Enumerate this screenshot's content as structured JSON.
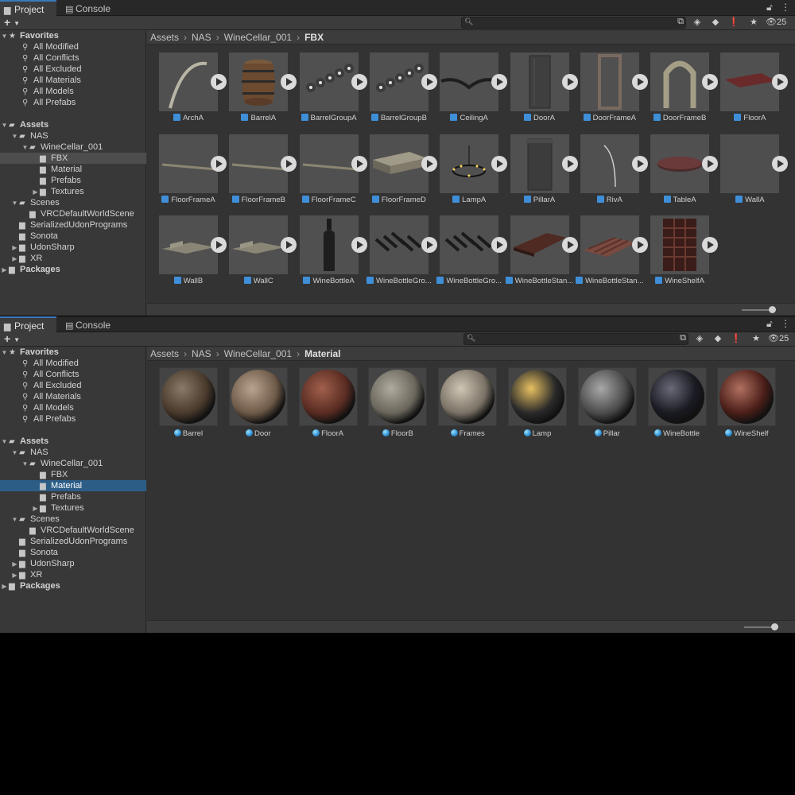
{
  "tabs": {
    "project": "Project",
    "console": "Console"
  },
  "toolbar": {
    "add": "+",
    "hidden_count": "25"
  },
  "tree": {
    "favorites": "Favorites",
    "fav_items": [
      "All Modified",
      "All Conflicts",
      "All Excluded",
      "All Materials",
      "All Models",
      "All Prefabs"
    ],
    "assets": "Assets",
    "nas": "NAS",
    "winecellar": "WineCellar_001",
    "fbx": "FBX",
    "material": "Material",
    "prefabs": "Prefabs",
    "textures": "Textures",
    "scenes": "Scenes",
    "vrcscene": "VRCDefaultWorldScene",
    "serialized": "SerializedUdonPrograms",
    "sonota": "Sonota",
    "udonsharp": "UdonSharp",
    "xr": "XR",
    "packages": "Packages"
  },
  "top": {
    "breadcrumb": [
      "Assets",
      "NAS",
      "WineCellar_001",
      "FBX"
    ],
    "selected_folder": "FBX",
    "assets": [
      {
        "name": "ArchA",
        "shape": "arch-curve"
      },
      {
        "name": "BarrelA",
        "shape": "barrel"
      },
      {
        "name": "BarrelGroupA",
        "shape": "barrel-group"
      },
      {
        "name": "BarrelGroupB",
        "shape": "barrel-group"
      },
      {
        "name": "CeilingA",
        "shape": "ceiling"
      },
      {
        "name": "DoorA",
        "shape": "door"
      },
      {
        "name": "DoorFrameA",
        "shape": "door-frame"
      },
      {
        "name": "DoorFrameB",
        "shape": "arch-frame"
      },
      {
        "name": "FloorA",
        "shape": "floor-plate"
      },
      {
        "name": "FloorFrameA",
        "shape": "beam"
      },
      {
        "name": "FloorFrameB",
        "shape": "beam"
      },
      {
        "name": "FloorFrameC",
        "shape": "beam"
      },
      {
        "name": "FloorFrameD",
        "shape": "slab"
      },
      {
        "name": "LampA",
        "shape": "chandelier"
      },
      {
        "name": "PillarA",
        "shape": "pillar"
      },
      {
        "name": "RivA",
        "shape": "rib"
      },
      {
        "name": "TableA",
        "shape": "table"
      },
      {
        "name": "WallA",
        "shape": "empty"
      },
      {
        "name": "WallB",
        "shape": "wall-plate"
      },
      {
        "name": "WallC",
        "shape": "wall-plate"
      },
      {
        "name": "WineBottleA",
        "shape": "bottle"
      },
      {
        "name": "WineBottleGro...",
        "shape": "bottle-group"
      },
      {
        "name": "WineBottleGro...",
        "shape": "bottle-group"
      },
      {
        "name": "WineBottleStan...",
        "shape": "stand"
      },
      {
        "name": "WineBottleStan...",
        "shape": "stand-rack"
      },
      {
        "name": "WineShelfA",
        "shape": "shelf"
      }
    ]
  },
  "bottom": {
    "breadcrumb": [
      "Assets",
      "NAS",
      "WineCellar_001",
      "Material"
    ],
    "selected_folder": "Material",
    "materials": [
      {
        "name": "Barrel",
        "base": "#4a3a2c",
        "hi": "#8a7a68"
      },
      {
        "name": "Door",
        "base": "#6e5a48",
        "hi": "#b8a48e"
      },
      {
        "name": "FloorA",
        "base": "#5a2c22",
        "hi": "#a0604c"
      },
      {
        "name": "FloorB",
        "base": "#6a665c",
        "hi": "#b0ab9e"
      },
      {
        "name": "Frames",
        "base": "#7a7266",
        "hi": "#cfc6b4"
      },
      {
        "name": "Lamp",
        "base": "#2a2a2a",
        "hi": "#e8c060"
      },
      {
        "name": "Pillar",
        "base": "#4c4c4c",
        "hi": "#a8a8a8"
      },
      {
        "name": "WineBottle",
        "base": "#1a1a22",
        "hi": "#6a6a78"
      },
      {
        "name": "WineShelf",
        "base": "#4a1e18",
        "hi": "#b07060"
      }
    ]
  }
}
